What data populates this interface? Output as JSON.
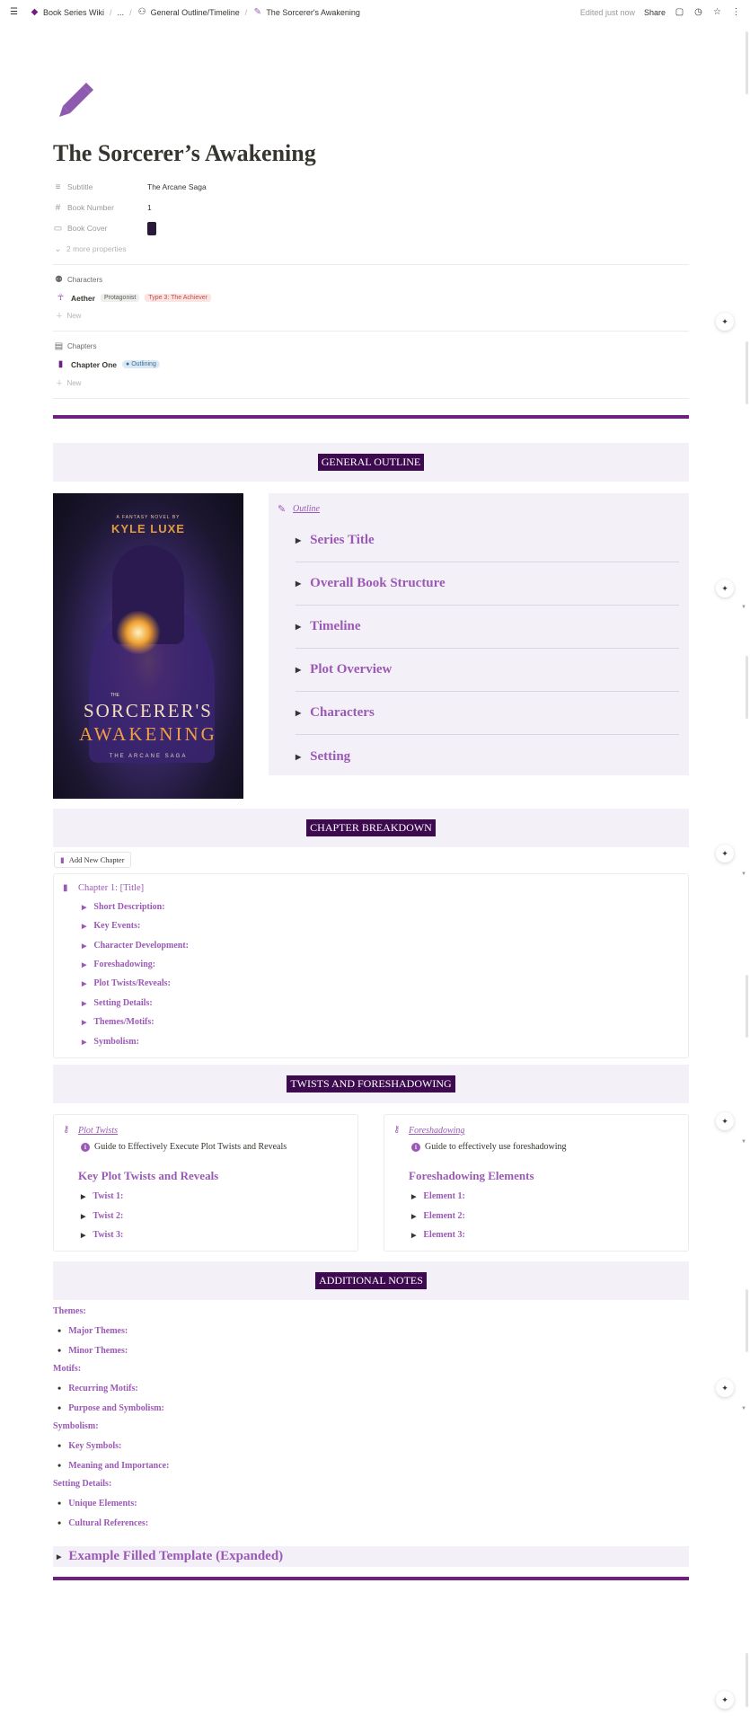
{
  "topbar": {
    "breadcrumbs": [
      "Book Series Wiki",
      "...",
      "General Outline/Timeline",
      "The Sorcerer's Awakening"
    ],
    "edited": "Edited just now",
    "share": "Share"
  },
  "page": {
    "title": "The Sorcerer’s Awakening",
    "icon": "pencil-icon"
  },
  "properties": {
    "subtitle_label": "Subtitle",
    "subtitle_value": "The Arcane Saga",
    "book_number_label": "Book Number",
    "book_number_value": "1",
    "book_cover_label": "Book Cover",
    "more": "2 more properties"
  },
  "characters": {
    "heading": "Characters",
    "name": "Aether",
    "tag1": "Protagonist",
    "tag2": "Type 3: The Achiever",
    "new": "New"
  },
  "chapters": {
    "heading": "Chapters",
    "name": "Chapter One",
    "status": "Outlining",
    "new": "New"
  },
  "general_outline": {
    "banner": "GENERAL OUTLINE",
    "panel_label": "Outline",
    "items": [
      "Series Title",
      "Overall Book Structure",
      "Timeline",
      "Plot Overview",
      "Characters",
      "Setting"
    ]
  },
  "cover": {
    "byline": "A FANTASY NOVEL BY",
    "author": "KYLE LUXE",
    "title_line1": "SORCERER'S",
    "title_line2": "AWAKENING",
    "small_the": "THE",
    "saga": "THE ARCANE SAGA"
  },
  "chapter_breakdown": {
    "banner": "CHAPTER BREAKDOWN",
    "add_button": "Add New Chapter",
    "chapter_title": "Chapter 1: [Title]",
    "items": [
      "Short Description:",
      "Key Events:",
      "Character Development:",
      "Foreshadowing:",
      "Plot Twists/Reveals:",
      "Setting Details:",
      "Themes/Motifs:",
      "Symbolism:"
    ]
  },
  "twists": {
    "banner": "TWISTS AND FORESHADOWING",
    "left": {
      "label": "Plot Twists",
      "note": "Guide to Effectively Execute Plot Twists and Reveals",
      "heading": "Key Plot Twists and Reveals",
      "items": [
        "Twist 1:",
        "Twist 2:",
        "Twist 3:"
      ]
    },
    "right": {
      "label": "Foreshadowing",
      "note": "Guide to effectively use foreshadowing",
      "heading": "Foreshadowing Elements",
      "items": [
        "Element 1:",
        "Element 2:",
        "Element 3:"
      ]
    }
  },
  "notes": {
    "banner": "ADDITIONAL NOTES",
    "themes": "Themes:",
    "themes_items": [
      "Major Themes:",
      "Minor Themes:"
    ],
    "motifs": "Motifs:",
    "motifs_items": [
      "Recurring Motifs:",
      "Purpose and Symbolism:"
    ],
    "symbolism": "Symbolism:",
    "symbolism_items": [
      "Key Symbols:",
      "Meaning and Importance:"
    ],
    "setting": "Setting Details:",
    "setting_items": [
      "Unique Elements:",
      "Cultural References:"
    ]
  },
  "example_toggle": "Example Filled Template (Expanded)",
  "colors": {
    "accent": "#9b59b6",
    "banner_bg": "#f4f0f8",
    "banner_label": "#3d0a4f",
    "rule": "#6f1f80"
  }
}
